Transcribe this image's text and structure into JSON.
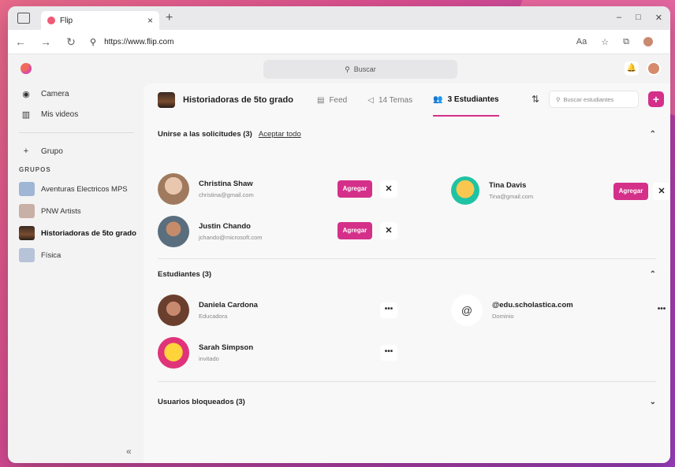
{
  "browser": {
    "tab_title": "Flip",
    "tab_close": "×",
    "new_tab": "+",
    "url": "https://www.flip.com",
    "window_controls": [
      "–",
      "□",
      "✕"
    ]
  },
  "app": {
    "search_placeholder": "Buscar",
    "sidebar": {
      "items": [
        {
          "label": "Camera",
          "icon": "camera-icon"
        },
        {
          "label": "Mis videos",
          "icon": "videos-icon"
        }
      ],
      "group_button": "Grupo",
      "groups_heading": "GRUPOS",
      "groups": [
        {
          "label": "Aventuras Electricos MPS",
          "color": "#9fb6d6"
        },
        {
          "label": "PNW Artists",
          "color": "#c9b0a6"
        },
        {
          "label": "Historiadoras de 5to grado",
          "color": "#5a3a28"
        },
        {
          "label": "Física",
          "color": "#b7c3d8"
        }
      ],
      "collapse": "«"
    },
    "group_header": {
      "title": "Historiadoras de 5to grado",
      "tabs": [
        {
          "label": "Feed",
          "icon": "▤"
        },
        {
          "label": "14 Temas",
          "icon": "◁"
        },
        {
          "label": "3 Estudiantes",
          "icon": "👥"
        }
      ],
      "search_placeholder": "Buscar estudiantes"
    },
    "requests": {
      "title": "Unirse a las solicitudes (3)",
      "accept_all": "Aceptar todo",
      "add_label": "Agregar",
      "people": [
        {
          "name": "Christina Shaw",
          "email": "christina@gmail.com",
          "color": "#c9a58a"
        },
        {
          "name": "Tina Davis",
          "email": "Tina@gmail.com",
          "color": "#1fc3a3"
        },
        {
          "name": "Justin Chando",
          "email": "jchando@microsoft.com",
          "color": "#5a6e7e"
        }
      ]
    },
    "students": {
      "title": "Estudiantes (3)",
      "people": [
        {
          "name": "Daniela Cardona",
          "role": "Educadora",
          "color": "#8c5a48"
        },
        {
          "name": "@edu.scholastica.com",
          "role": "Dominio",
          "color": "#ffffff"
        },
        {
          "name": "Sarah Simpson",
          "role": "invitado",
          "color": "#e0347a"
        }
      ],
      "more": "•••"
    },
    "blocked": {
      "title": "Usuarios bloqueados (3)"
    },
    "accent": "#d4308a"
  }
}
